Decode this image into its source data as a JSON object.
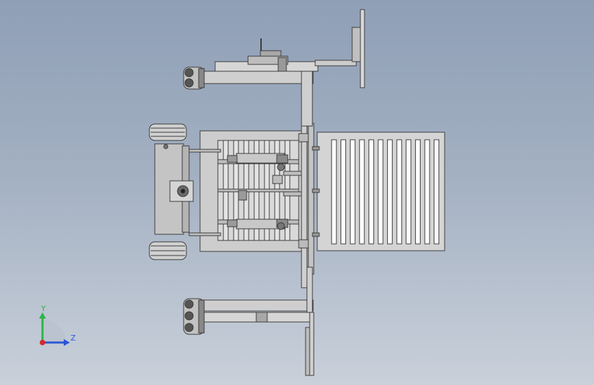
{
  "triad": {
    "y_label": "Y",
    "z_label": "Z",
    "colors": {
      "y": "#2bb34a",
      "z": "#2a57d6",
      "origin": "#d42a2a"
    }
  },
  "colors": {
    "frame_fill": "#d8d8d8",
    "frame_stroke": "#3a3a3a",
    "panel_fill": "#cfcfcf",
    "slot_fill": "#ffffff",
    "dark_part": "#555555"
  }
}
